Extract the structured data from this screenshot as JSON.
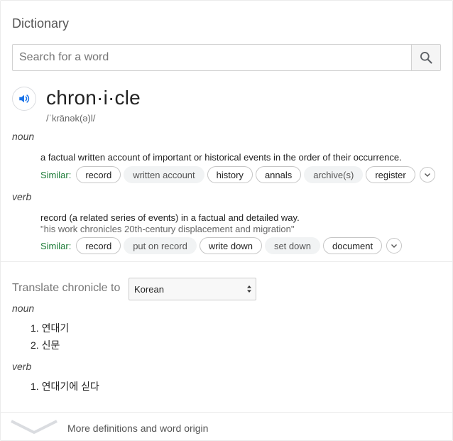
{
  "card": {
    "title": "Dictionary"
  },
  "search": {
    "placeholder": "Search for a word",
    "value": ""
  },
  "entry": {
    "headword": "chron·i·cle",
    "phonetic": "/ˈkränək(ə)l/"
  },
  "senses": [
    {
      "pos": "noun",
      "definition": "a factual written account of important or historical events in the order of their occurrence.",
      "similar_label": "Similar:",
      "similar": [
        "record",
        "written account",
        "history",
        "annals",
        "archive(s)",
        "register"
      ]
    },
    {
      "pos": "verb",
      "definition": "record (a related series of events) in a factual and detailed way.",
      "example": "\"his work chronicles 20th-century displacement and migration\"",
      "similar_label": "Similar:",
      "similar": [
        "record",
        "put on record",
        "write down",
        "set down",
        "document"
      ]
    }
  ],
  "translate": {
    "label": "Translate chronicle to",
    "language": "Korean",
    "groups": [
      {
        "pos": "noun",
        "items": [
          "1. 연대기",
          "2. 신문"
        ]
      },
      {
        "pos": "verb",
        "items": [
          "1. 연대기에 싣다"
        ]
      }
    ]
  },
  "footer": {
    "more_label": "More definitions and word origin"
  },
  "colors": {
    "similar_green": "#1a7a35",
    "speaker_blue": "#1a73e8"
  }
}
